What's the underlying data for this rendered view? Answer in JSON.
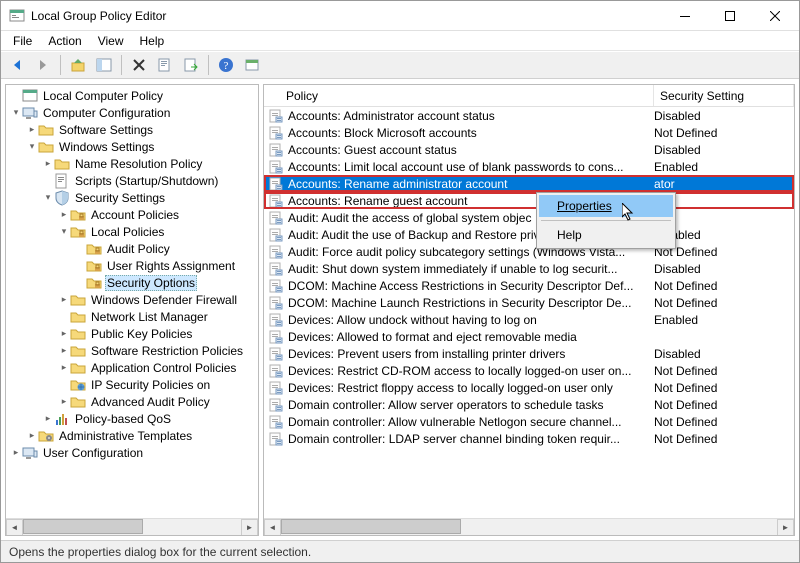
{
  "window": {
    "title": "Local Group Policy Editor",
    "minimize": "—",
    "maximize": "□",
    "close": "✕"
  },
  "menubar": [
    "File",
    "Action",
    "View",
    "Help"
  ],
  "tree": {
    "root": "Local Computer Policy",
    "cc": "Computer Configuration",
    "sw": "Software Settings",
    "ws": "Windows Settings",
    "nrp": "Name Resolution Policy",
    "scripts": "Scripts (Startup/Shutdown)",
    "ss": "Security Settings",
    "ap": "Account Policies",
    "lp": "Local Policies",
    "aup": "Audit Policy",
    "ura": "User Rights Assignment",
    "so": "Security Options",
    "wdf": "Windows Defender Firewall",
    "nlm": "Network List Manager",
    "pkp": "Public Key Policies",
    "srp": "Software Restriction Policies",
    "acp": "Application Control Policies",
    "ips": "IP Security Policies on",
    "aap": "Advanced Audit Policy",
    "pq": "Policy-based QoS",
    "at": "Administrative Templates",
    "uc": "User Configuration"
  },
  "columns": {
    "policy": "Policy",
    "setting": "Security Setting"
  },
  "rows": [
    {
      "policy": "Accounts: Administrator account status",
      "setting": "Disabled"
    },
    {
      "policy": "Accounts: Block Microsoft accounts",
      "setting": "Not Defined"
    },
    {
      "policy": "Accounts: Guest account status",
      "setting": "Disabled"
    },
    {
      "policy": "Accounts: Limit local account use of blank passwords to cons...",
      "setting": "Enabled"
    },
    {
      "policy": "Accounts: Rename administrator account",
      "setting": "ator",
      "selected": true,
      "highlight": true
    },
    {
      "policy": "Accounts: Rename guest account",
      "setting": "",
      "highlight": true
    },
    {
      "policy": "Audit: Audit the access of global system objec",
      "setting": ""
    },
    {
      "policy": "Audit: Audit the use of Backup and Restore privilege",
      "setting": "Disabled"
    },
    {
      "policy": "Audit: Force audit policy subcategory settings (Windows Vista...",
      "setting": "Not Defined"
    },
    {
      "policy": "Audit: Shut down system immediately if unable to log securit...",
      "setting": "Disabled"
    },
    {
      "policy": "DCOM: Machine Access Restrictions in Security Descriptor Def...",
      "setting": "Not Defined"
    },
    {
      "policy": "DCOM: Machine Launch Restrictions in Security Descriptor De...",
      "setting": "Not Defined"
    },
    {
      "policy": "Devices: Allow undock without having to log on",
      "setting": "Enabled"
    },
    {
      "policy": "Devices: Allowed to format and eject removable media",
      "setting": ""
    },
    {
      "policy": "Devices: Prevent users from installing printer drivers",
      "setting": "Disabled"
    },
    {
      "policy": "Devices: Restrict CD-ROM access to locally logged-on user on...",
      "setting": "Not Defined"
    },
    {
      "policy": "Devices: Restrict floppy access to locally logged-on user only",
      "setting": "Not Defined"
    },
    {
      "policy": "Domain controller: Allow server operators to schedule tasks",
      "setting": "Not Defined"
    },
    {
      "policy": "Domain controller: Allow vulnerable Netlogon secure channel...",
      "setting": "Not Defined"
    },
    {
      "policy": "Domain controller: LDAP server channel binding token requir...",
      "setting": "Not Defined"
    }
  ],
  "context_menu": {
    "properties": "Properties",
    "help": "Help"
  },
  "statusbar": "Opens the properties dialog box for the current selection."
}
